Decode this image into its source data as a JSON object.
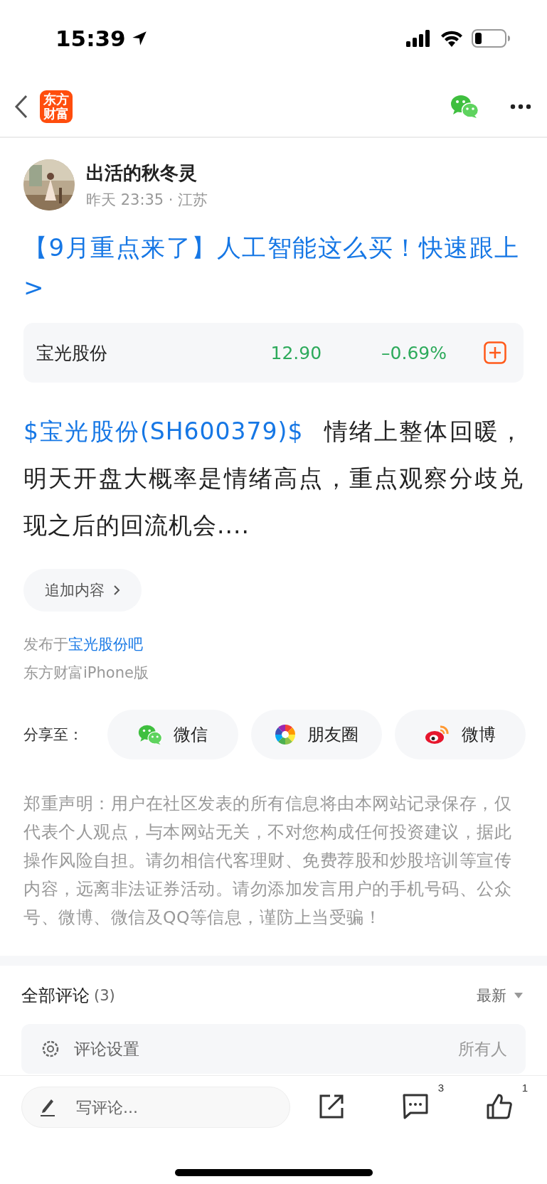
{
  "status_bar": {
    "time": "15:39"
  },
  "nav": {
    "logo_lines": [
      "东方",
      "财富"
    ]
  },
  "author": {
    "name": "出活的秋冬灵",
    "meta": "昨天 23:35 · 江苏"
  },
  "title": "【9月重点来了】人工智能这么买！快速跟上>",
  "stock_card": {
    "name": "宝光股份",
    "price": "12.90",
    "change": "–0.69%",
    "color": "#2daa5b"
  },
  "body": {
    "stock_tag": "$宝光股份(SH600379)$",
    "text": "情绪上整体回暖，明天开盘大概率是情绪高点，重点观察分歧兑现之后的回流机会...."
  },
  "append_button": "追加内容",
  "published": {
    "prefix": "发布于",
    "forum": "宝光股份吧"
  },
  "source": "东方财富iPhone版",
  "share": {
    "label": "分享至：",
    "targets": [
      {
        "kind": "wechat",
        "label": "微信"
      },
      {
        "kind": "moments",
        "label": "朋友圈"
      },
      {
        "kind": "weibo",
        "label": "微博"
      }
    ]
  },
  "disclaimer": "郑重声明：用户在社区发表的所有信息将由本网站记录保存，仅代表个人观点，与本网站无关，不对您构成任何投资建议，据此操作风险自担。请勿相信代客理财、免费荐股和炒股培训等宣传内容，远离非法证券活动。请勿添加发言用户的手机号码、公众号、微博、微信及QQ等信息，谨防上当受骗！",
  "comments": {
    "title": "全部评论",
    "count": "(3)",
    "sort": "最新",
    "settings": {
      "label": "评论设置",
      "value": "所有人"
    }
  },
  "bottom_bar": {
    "placeholder": "写评论...",
    "comment_count": "3",
    "like_count": "1"
  }
}
